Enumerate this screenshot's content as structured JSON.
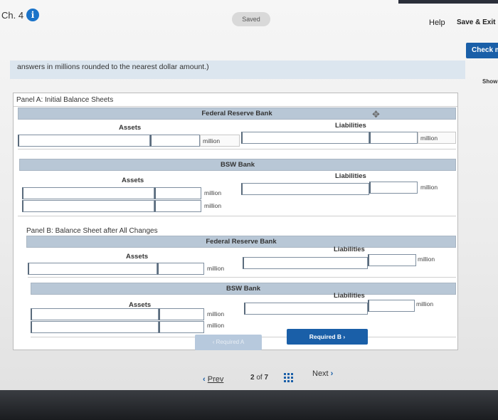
{
  "header": {
    "chapter": "Ch. 4",
    "saved": "Saved",
    "help": "Help",
    "save_exit": "Save & Exit",
    "check": "Check m",
    "show": "Show"
  },
  "instruction": "answers in millions rounded to the nearest dollar amount.)",
  "panel_a": {
    "title": "Panel A: Initial Balance Sheets",
    "federal_reserve": {
      "header": "Federal Reserve Bank",
      "assets_label": "Assets",
      "liabilities_label": "Liabilities",
      "assets_unit": "million",
      "liabilities_unit": "million"
    },
    "bsw": {
      "header": "BSW Bank",
      "assets_label": "Assets",
      "liabilities_label": "Liabilities",
      "assets_unit_1": "million",
      "assets_unit_2": "million",
      "liabilities_unit": "million"
    }
  },
  "panel_b": {
    "title": "Panel B: Balance Sheet after All Changes",
    "federal_reserve": {
      "header": "Federal Reserve Bank",
      "assets_label": "Assets",
      "liabilities_label": "Liabilities",
      "assets_unit": "million",
      "liabilities_unit": "million"
    },
    "bsw": {
      "header": "BSW Bank",
      "assets_label": "Assets",
      "liabilities_label": "Liabilities",
      "assets_unit_1": "million",
      "assets_unit_2": "million",
      "liabilities_unit": "million"
    }
  },
  "nav": {
    "required_a": "Required A",
    "required_b": "Required B",
    "prev": "Prev",
    "page_current": "2",
    "page_of": "of",
    "page_total": "7",
    "next": "Next"
  }
}
